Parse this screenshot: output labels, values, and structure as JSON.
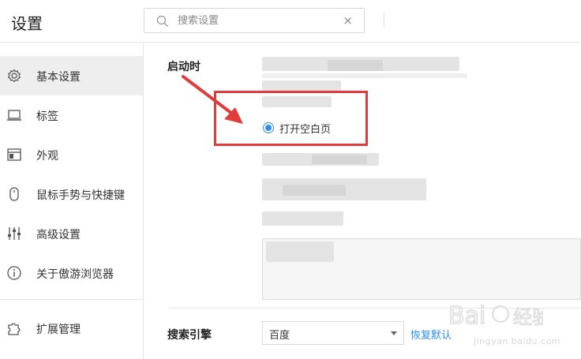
{
  "header": {
    "title": "设置",
    "search": {
      "placeholder": "搜索设置",
      "value": ""
    },
    "clear_glyph": "×"
  },
  "sidebar": {
    "items": [
      {
        "label": "基本设置",
        "icon": "gear-icon",
        "active": true
      },
      {
        "label": "标签",
        "icon": "laptop-icon",
        "active": false
      },
      {
        "label": "外观",
        "icon": "window-icon",
        "active": false
      },
      {
        "label": "鼠标手势与快捷键",
        "icon": "mouse-icon",
        "active": false
      },
      {
        "label": "高级设置",
        "icon": "sliders-icon",
        "active": false
      },
      {
        "label": "关于傲游浏览器",
        "icon": "info-icon",
        "active": false
      },
      {
        "label": "扩展管理",
        "icon": "puzzle-icon",
        "active": false
      }
    ]
  },
  "main": {
    "startup": {
      "label": "启动时",
      "selected_option": "打开空白页"
    },
    "search_engine": {
      "label": "搜索引擎",
      "selected": "百度",
      "restore_label": "恢复默认"
    }
  },
  "annotation": {
    "color": "#e03c3c"
  },
  "accent": "#2d8cf0",
  "watermark": {
    "text": "jingyan.baidu.com"
  }
}
